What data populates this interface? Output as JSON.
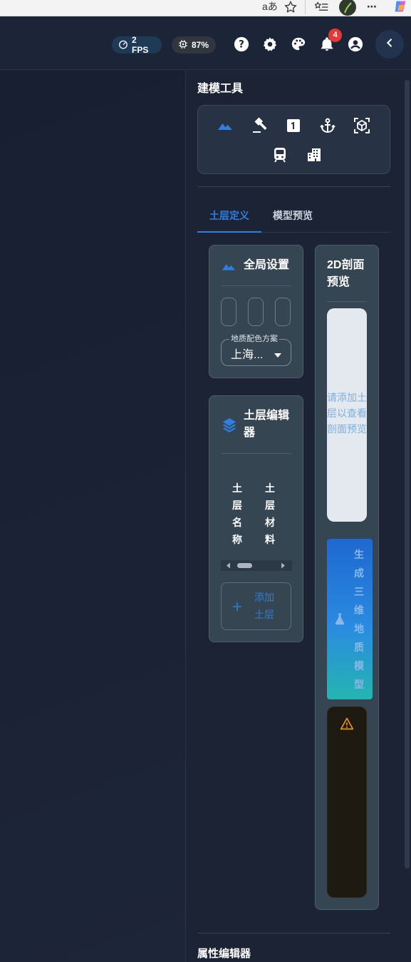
{
  "browser": {
    "read_aloud_label": "aあ",
    "menu_label": "⋯"
  },
  "appbar": {
    "fps_text": "2 FPS",
    "cpu_text": "87%",
    "notification_count": "4"
  },
  "sidebar": {
    "modeling_tools_title": "建模工具",
    "tabs": [
      {
        "label": "土层定义",
        "active": true
      },
      {
        "label": "模型预览",
        "active": false
      }
    ],
    "global_settings": {
      "title": "全局设置",
      "color_scheme_label": "地质配色方案",
      "color_scheme_value": "上海..."
    },
    "soil_editor": {
      "title_line1": "土层编辑",
      "title_line2": "器",
      "columns": [
        "土层名称",
        "土层材料"
      ],
      "add_button_label": "添加土层"
    },
    "preview_2d": {
      "title_line1": "2D剖面",
      "title_line2": "预览",
      "empty_text": "请添加土层以查看剖面预览"
    },
    "generate_button_label": "生成三维地质模型",
    "property_editor_title": "属性编辑器"
  },
  "colors": {
    "accent": "#2d7fe0",
    "background": "#1b2233",
    "card": "#354552",
    "warning": "#e8951f"
  }
}
